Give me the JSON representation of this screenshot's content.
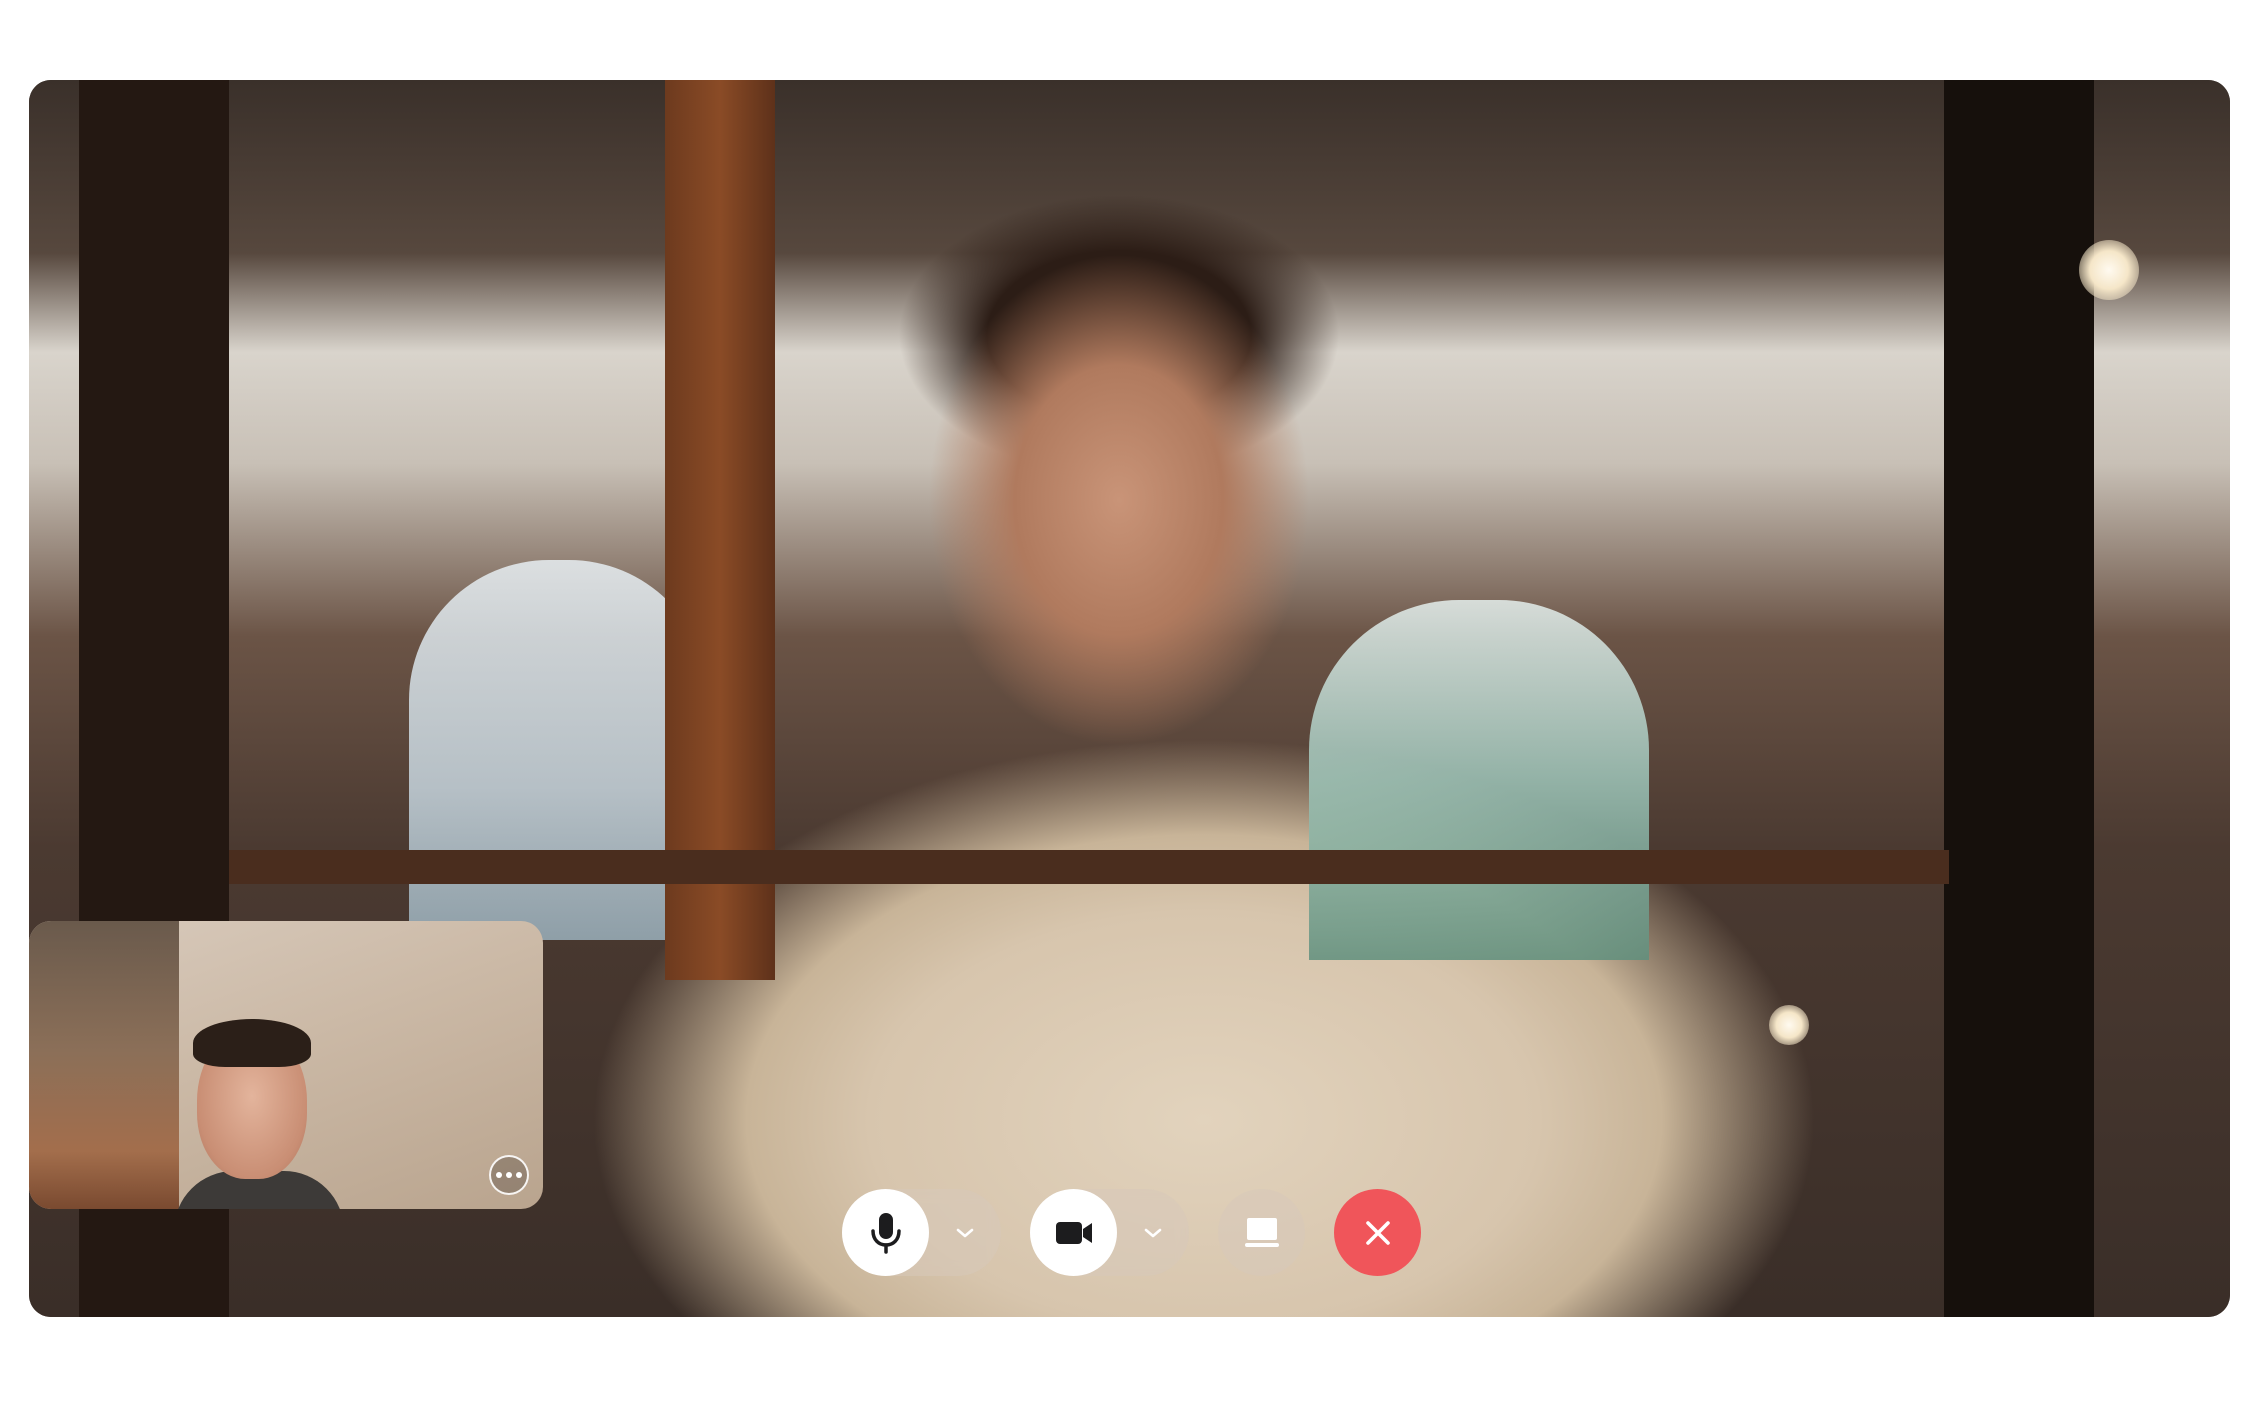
{
  "call": {
    "remote_participant": "remote-video",
    "self_view": "self-video"
  },
  "controls": {
    "microphone": {
      "icon": "microphone-icon",
      "menu_icon": "chevron-down-icon"
    },
    "camera": {
      "icon": "video-camera-icon",
      "menu_icon": "chevron-down-icon"
    },
    "share_screen": {
      "icon": "screen-share-icon"
    },
    "end_call": {
      "icon": "close-icon",
      "color": "#f0555a"
    }
  },
  "self_view_menu": {
    "icon": "more-horizontal-icon"
  }
}
